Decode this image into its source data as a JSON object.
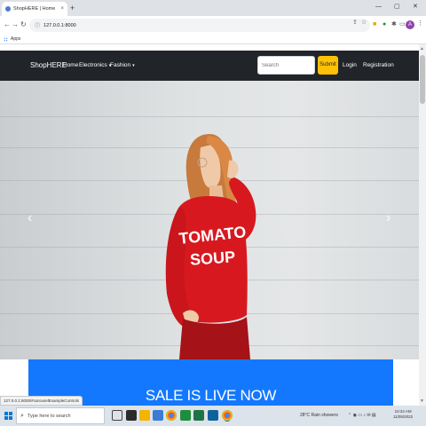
{
  "browser": {
    "tab_title": "ShopHERE | Home",
    "tab_close": "×",
    "new_tab": "+",
    "window_controls": {
      "minimize": "—",
      "maximize": "▢",
      "close": "✕"
    },
    "nav": {
      "back": "←",
      "forward": "→",
      "reload": "↻"
    },
    "url": "127.0.0.1:8000",
    "bookmarks_label": "Apps",
    "profile_initial": "A",
    "menu": "⋮"
  },
  "navbar": {
    "brand": "ShopHERE",
    "links": [
      {
        "label": "Home"
      },
      {
        "label": "Electronics",
        "caret": "▾"
      },
      {
        "label": "Fashion",
        "caret": "▾"
      }
    ],
    "search_placeholder": "Search",
    "submit_label": "Submit",
    "login_label": "Login",
    "register_label": "Registration"
  },
  "carousel": {
    "prev": "‹",
    "next": "›",
    "shirt_text_line1": "TOMATO",
    "shirt_text_line2": "SOUP"
  },
  "banner": {
    "text": "SALE IS LIVE NOW"
  },
  "status_url": "127.0.0.1:8000/#carouselExampleControls",
  "taskbar": {
    "search_placeholder": "Type here to search",
    "weather": "28°C  Rain showers",
    "time": "10:34 AM",
    "date": "11/05/2022"
  },
  "colors": {
    "navbar_bg": "#212529",
    "submit_bg": "#ffc107",
    "banner_bg": "#1478ff",
    "sweater": "#d7191f"
  }
}
